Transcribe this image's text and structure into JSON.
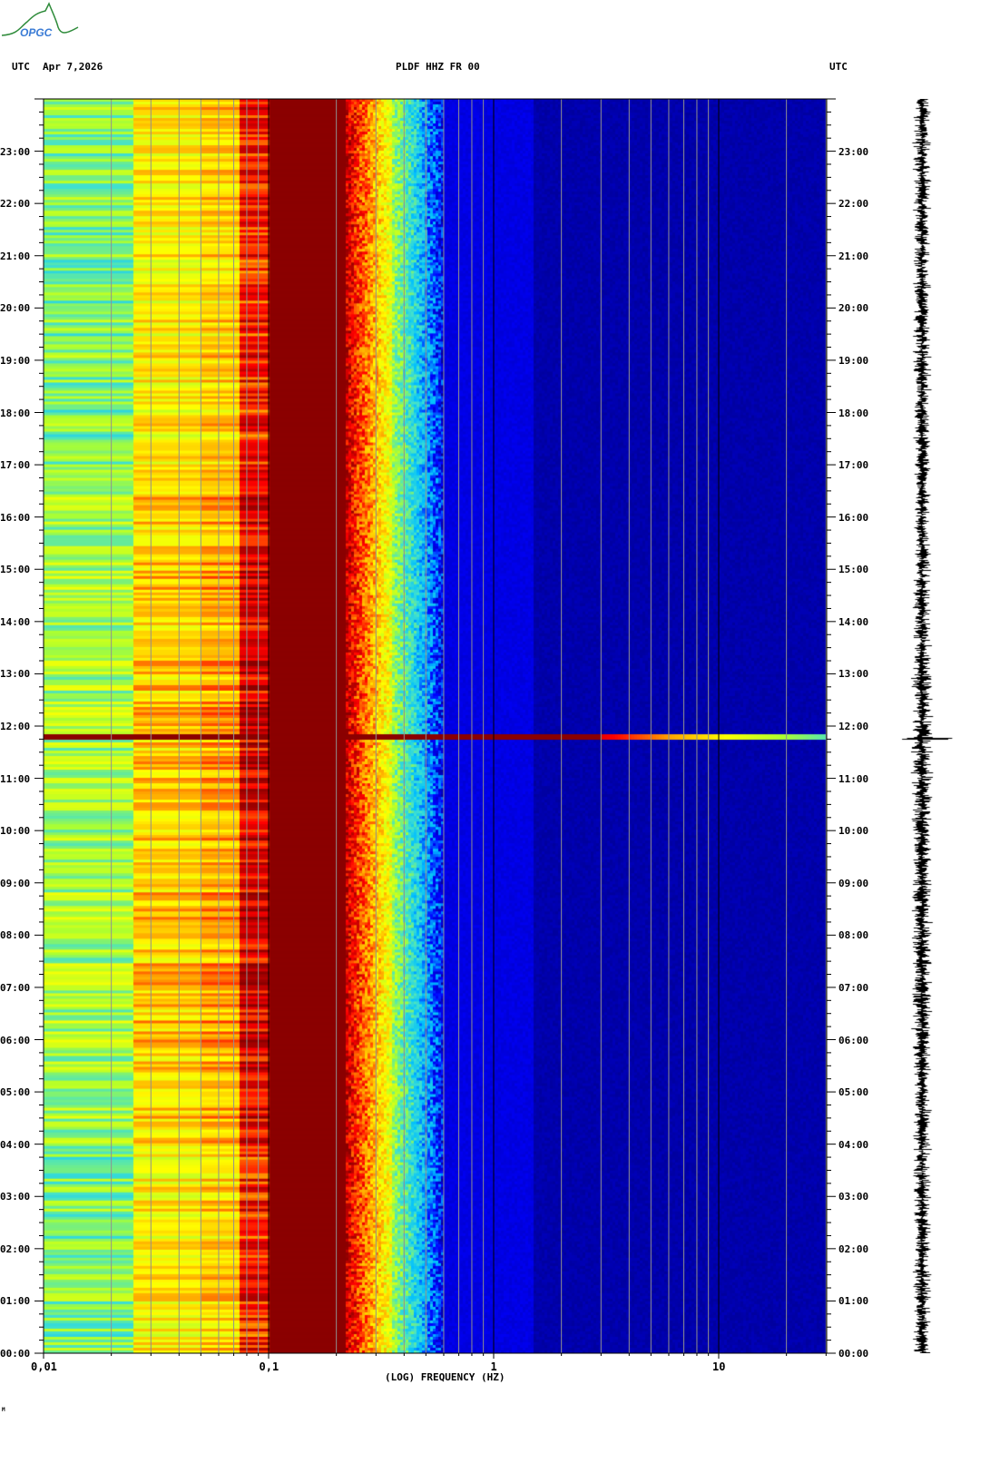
{
  "logo": {
    "text": "OPGC"
  },
  "header": {
    "left_tz": "UTC",
    "date": "Apr 7,2026",
    "station": "PLDF HHZ FR 00",
    "right_tz": "UTC"
  },
  "footer_mark": "M",
  "chart_data": {
    "type": "heatmap",
    "title": "PLDF HHZ FR 00",
    "xlabel": "(LOG) FREQUENCY (HZ)",
    "ylabel": "UTC",
    "xscale": "log",
    "xlim": [
      0.01,
      30
    ],
    "x_ticks": [
      {
        "v": 0.01,
        "label": "0,01"
      },
      {
        "v": 0.1,
        "label": "0,1"
      },
      {
        "v": 1,
        "label": "1"
      },
      {
        "v": 10,
        "label": "10"
      }
    ],
    "ylim_hours": [
      0,
      24
    ],
    "y_ticks": [
      "00:00",
      "01:00",
      "02:00",
      "03:00",
      "04:00",
      "05:00",
      "06:00",
      "07:00",
      "08:00",
      "09:00",
      "10:00",
      "11:00",
      "12:00",
      "13:00",
      "14:00",
      "15:00",
      "16:00",
      "17:00",
      "18:00",
      "19:00",
      "20:00",
      "21:00",
      "22:00",
      "23:00"
    ],
    "colormap": [
      "#00008b",
      "#0000ff",
      "#00bfff",
      "#40e0d0",
      "#adff2f",
      "#ffff00",
      "#ffa500",
      "#ff0000",
      "#8b0000"
    ],
    "bands": [
      {
        "fmin": 0.01,
        "fmax": 0.025,
        "level": "cyan-green"
      },
      {
        "fmin": 0.025,
        "fmax": 0.05,
        "level": "yellow"
      },
      {
        "fmin": 0.05,
        "fmax": 0.073,
        "level": "yellow-orange"
      },
      {
        "fmin": 0.073,
        "fmax": 0.1,
        "level": "red"
      },
      {
        "fmin": 0.1,
        "fmax": 0.22,
        "level": "dark-red"
      },
      {
        "fmin": 0.22,
        "fmax": 0.35,
        "level": "red-yellow"
      },
      {
        "fmin": 0.35,
        "fmax": 0.6,
        "level": "cyan-blue"
      },
      {
        "fmin": 0.6,
        "fmax": 30,
        "level": "dark-blue"
      }
    ],
    "events": [
      {
        "time_hours": 11.78,
        "description": "broadband signal",
        "fmax": 30
      }
    ]
  }
}
